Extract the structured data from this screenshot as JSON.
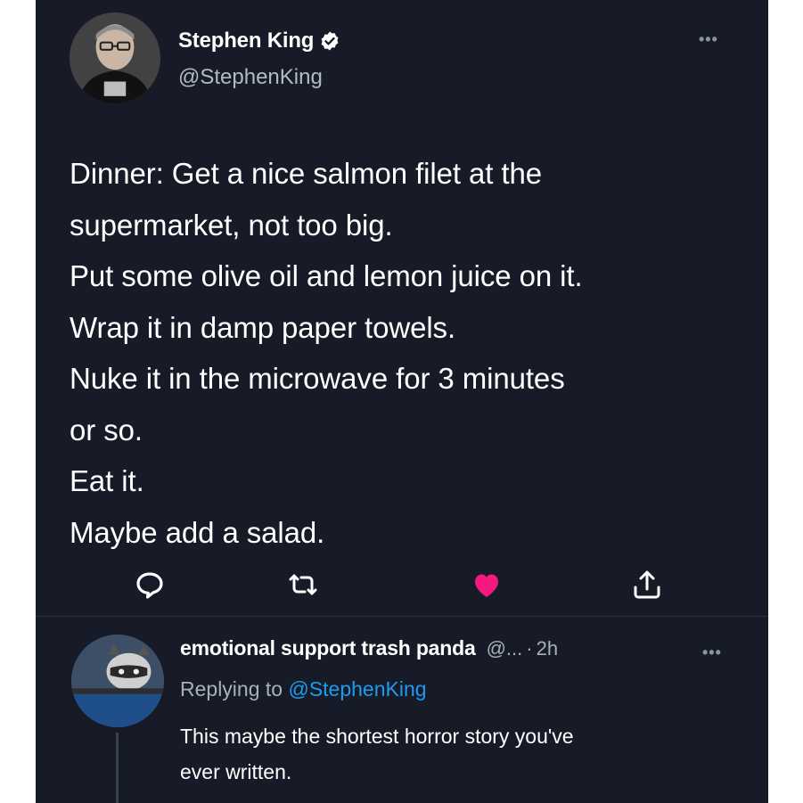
{
  "colors": {
    "background": "#161b27",
    "text": "#ffffff",
    "muted": "#a9b0b8",
    "link": "#1d9bf0",
    "like_active": "#f91880"
  },
  "tweet": {
    "author": {
      "display_name": "Stephen King",
      "handle": "@StephenKing",
      "verified": true,
      "avatar_icon": "profile-photo"
    },
    "more_label": "•••",
    "lines": [
      "Dinner: Get a nice salmon filet at the",
      "supermarket, not too big.",
      "Put some olive oil and lemon juice on it.",
      "Wrap it in damp paper towels.",
      "Nuke it in the microwave for 3 minutes",
      "or so.",
      "Eat it.",
      "Maybe add a salad."
    ],
    "actions": [
      {
        "name": "reply",
        "icon": "speech-bubble-icon"
      },
      {
        "name": "retweet",
        "icon": "retweet-icon"
      },
      {
        "name": "like",
        "icon": "heart-icon",
        "active": true
      },
      {
        "name": "share",
        "icon": "share-icon"
      }
    ]
  },
  "reply": {
    "display_name": "emotional support trash panda",
    "handle": "@...",
    "separator": "·",
    "time": "2h",
    "more_label": "•••",
    "replying_prefix": "Replying to",
    "replying_to": "@StephenKing",
    "lines": [
      "This maybe the shortest horror story you've",
      "ever written."
    ],
    "avatar_icon": "raccoon-photo"
  }
}
